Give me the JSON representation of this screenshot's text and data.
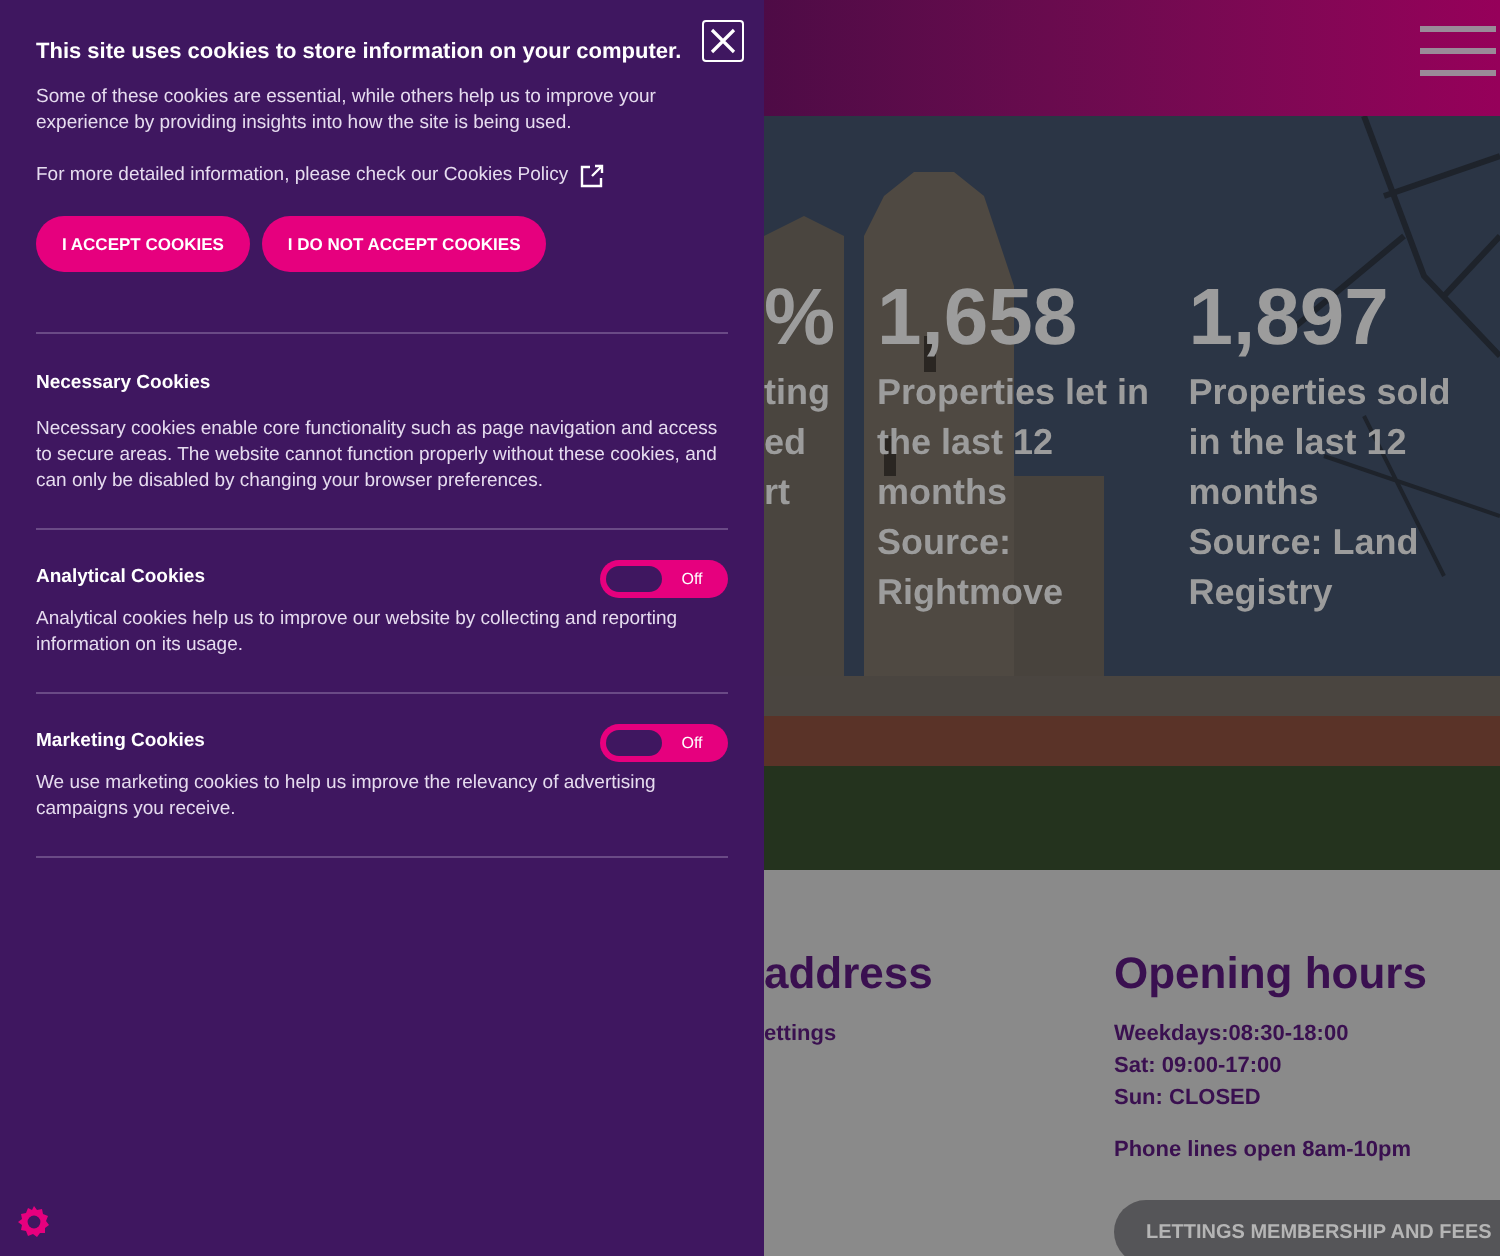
{
  "cookie_panel": {
    "title": "This site uses cookies to store information on your computer.",
    "intro": "Some of these cookies are essential, while others help us to improve your experience by providing insights into how the site is being used.",
    "policy_text": "For more detailed information, please check our Cookies Policy",
    "buttons": [
      "I ACCEPT COOKIES",
      "I DO NOT ACCEPT COOKIES"
    ],
    "categories": [
      {
        "kind": "fixed",
        "title": "Necessary Cookies",
        "description": "Necessary cookies enable core functionality such as page navigation and access to secure areas. The website cannot function properly without these cookies, and can only be disabled by changing your browser preferences."
      },
      {
        "kind": "toggle",
        "title": "Analytical Cookies",
        "description": "Analytical cookies help us to improve our website by collecting and reporting information on its usage.",
        "on": false,
        "state_label": "Off"
      },
      {
        "kind": "toggle",
        "title": "Marketing Cookies",
        "description": "We use marketing cookies to help us improve the relevancy of advertising campaigns you receive.",
        "on": false,
        "state_label": "Off"
      }
    ]
  },
  "page": {
    "stats": [
      {
        "number": "%",
        "lines": [
          "ting",
          "ed",
          "rt"
        ]
      },
      {
        "number": "1,658",
        "lines": [
          "Properties let in",
          "the last 12",
          "months",
          "Source:",
          "Rightmove"
        ]
      },
      {
        "number": "1,897",
        "lines": [
          "Properties sold",
          "in the last 12",
          "months",
          "Source: Land",
          "Registry"
        ]
      }
    ],
    "address": {
      "heading": "address",
      "lines": [
        "ettings"
      ]
    },
    "hours": {
      "heading": "Opening hours",
      "lines": [
        "Weekdays:08:30-18:00",
        "Sat: 09:00-17:00",
        "Sun: CLOSED"
      ],
      "note": "Phone lines open 8am-10pm"
    },
    "fees_button": "LETTINGS MEMBERSHIP AND FEES"
  }
}
